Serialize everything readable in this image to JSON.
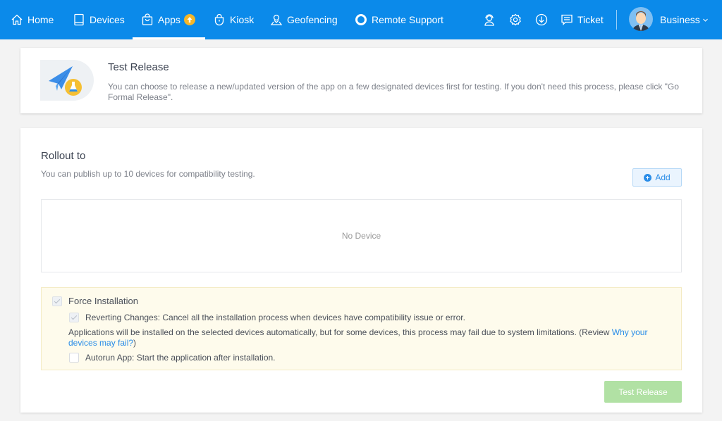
{
  "nav": {
    "items": [
      {
        "label": "Home",
        "icon": "home-icon"
      },
      {
        "label": "Devices",
        "icon": "tablet-icon"
      },
      {
        "label": "Apps",
        "icon": "shopping-bag-icon",
        "active": true,
        "badge": "upgrade-arrow"
      },
      {
        "label": "Kiosk",
        "icon": "lock-icon"
      },
      {
        "label": "Geofencing",
        "icon": "map-pin-icon"
      },
      {
        "label": "Remote Support",
        "icon": "lifebuoy-icon"
      }
    ],
    "utility_icons": [
      "headset-support-icon",
      "gear-icon",
      "download-icon"
    ],
    "ticket_label": "Ticket",
    "user_label": "Business"
  },
  "header_card": {
    "title": "Test Release",
    "description": "You can choose to release a new/updated version of the app on a few designated devices first for testing. If you don't need this process, please click \"Go Formal Release\"."
  },
  "rollout": {
    "title": "Rollout to",
    "subtitle": "You can publish up to 10 devices for compatibility testing.",
    "add_label": "Add",
    "empty_text": "No Device",
    "force_installation": {
      "label": "Force Installation",
      "checked": true,
      "reverting_label": "Reverting Changes: Cancel all the installation process when devices have compatibility issue or error.",
      "reverting_checked": true,
      "note_text": "Applications will be installed on the selected devices automatically, but for some devices, this process may fail due to system limitations. (Review ",
      "note_link": "Why your devices may fail?",
      "note_suffix": ")",
      "autorun_label": "Autorun App: Start the application after installation.",
      "autorun_checked": false
    },
    "submit_label": "Test Release"
  },
  "colors": {
    "brand": "#0b8aea",
    "badge": "#f5b628",
    "link": "#2a8de8",
    "submit_disabled": "#b1e1a4",
    "notice_bg": "#fefbec"
  }
}
